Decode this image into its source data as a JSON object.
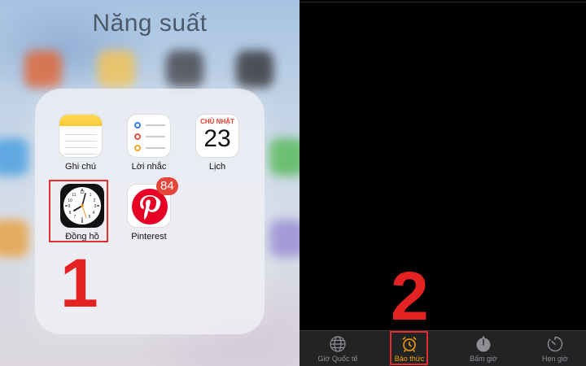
{
  "folder": {
    "title": "Năng suất",
    "apps": [
      {
        "label": "Ghi chú"
      },
      {
        "label": "Lời nhắc"
      },
      {
        "label": "Lịch",
        "day": "CHỦ NHẬT",
        "date": "23"
      },
      {
        "label": "Đồng hồ"
      },
      {
        "label": "Pinterest",
        "badge": "84"
      }
    ]
  },
  "steps": [
    "1",
    "2"
  ],
  "tabbar": {
    "tabs": [
      {
        "label": "Giờ Quốc tế",
        "icon": "globe-icon"
      },
      {
        "label": "Báo thức",
        "icon": "alarm-clock-icon",
        "active": true
      },
      {
        "label": "Bấm giờ",
        "icon": "stopwatch-icon"
      },
      {
        "label": "Hẹn giờ",
        "icon": "timer-icon"
      }
    ]
  },
  "colors": {
    "highlight": "#e52d2d",
    "active_tab": "#f7a300",
    "inactive_tab": "#8e8e93",
    "badge": "#e5453a",
    "pinterest": "#e60023"
  }
}
